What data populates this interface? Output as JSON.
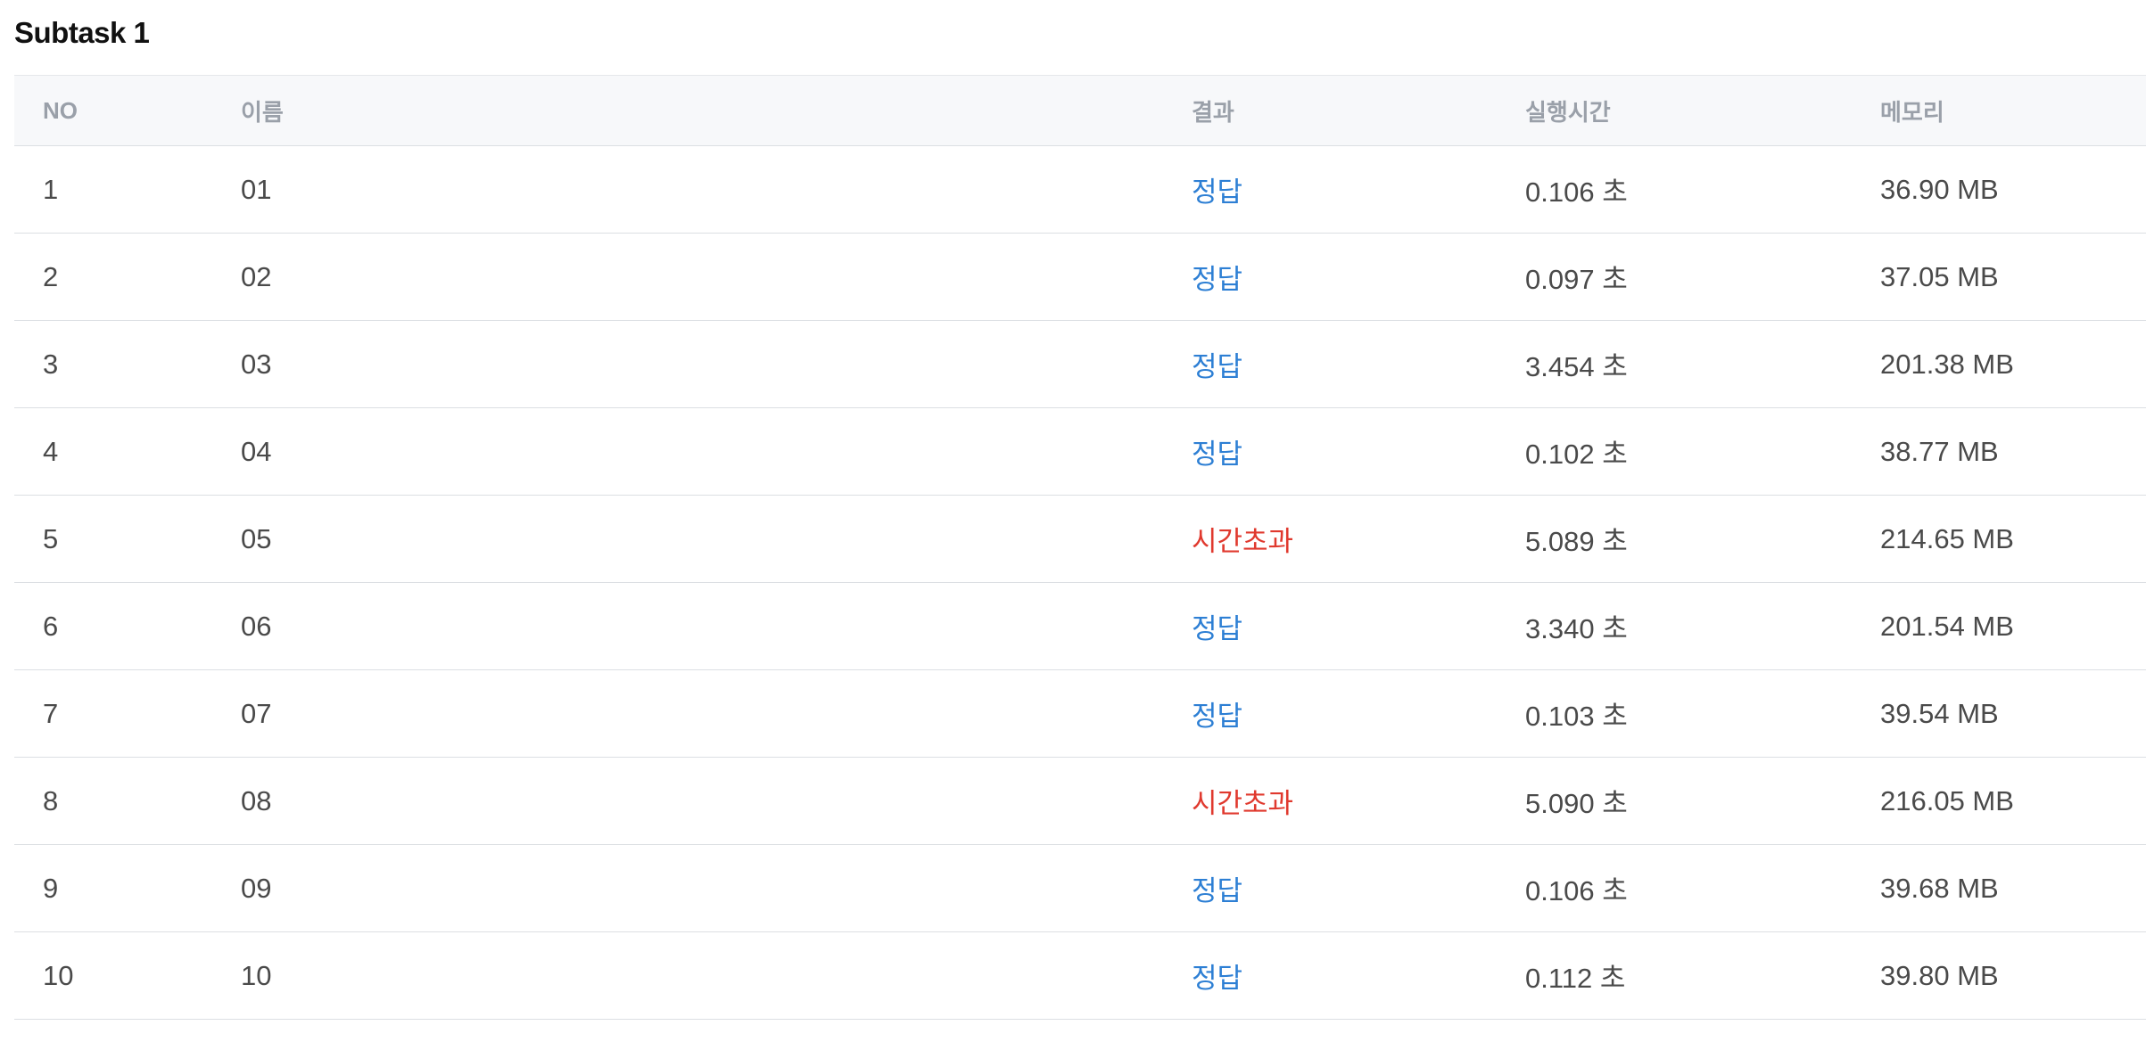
{
  "subtask": {
    "title": "Subtask 1"
  },
  "colors": {
    "accepted": "#2d7fd4",
    "time_limit_exceeded": "#e0392e",
    "header_text": "#9aa0a9",
    "header_bg": "#f7f8fa"
  },
  "table": {
    "headers": {
      "no": "NO",
      "name": "이름",
      "result": "결과",
      "time": "실행시간",
      "memory": "메모리"
    },
    "rows": [
      {
        "no": "1",
        "name": "01",
        "result": "정답",
        "status": "ok",
        "time": "0.106 초",
        "memory": "36.90 MB"
      },
      {
        "no": "2",
        "name": "02",
        "result": "정답",
        "status": "ok",
        "time": "0.097 초",
        "memory": "37.05 MB"
      },
      {
        "no": "3",
        "name": "03",
        "result": "정답",
        "status": "ok",
        "time": "3.454 초",
        "memory": "201.38 MB"
      },
      {
        "no": "4",
        "name": "04",
        "result": "정답",
        "status": "ok",
        "time": "0.102 초",
        "memory": "38.77 MB"
      },
      {
        "no": "5",
        "name": "05",
        "result": "시간초과",
        "status": "tle",
        "time": "5.089 초",
        "memory": "214.65 MB"
      },
      {
        "no": "6",
        "name": "06",
        "result": "정답",
        "status": "ok",
        "time": "3.340 초",
        "memory": "201.54 MB"
      },
      {
        "no": "7",
        "name": "07",
        "result": "정답",
        "status": "ok",
        "time": "0.103 초",
        "memory": "39.54 MB"
      },
      {
        "no": "8",
        "name": "08",
        "result": "시간초과",
        "status": "tle",
        "time": "5.090 초",
        "memory": "216.05 MB"
      },
      {
        "no": "9",
        "name": "09",
        "result": "정답",
        "status": "ok",
        "time": "0.106 초",
        "memory": "39.68 MB"
      },
      {
        "no": "10",
        "name": "10",
        "result": "정답",
        "status": "ok",
        "time": "0.112 초",
        "memory": "39.80 MB"
      }
    ]
  }
}
